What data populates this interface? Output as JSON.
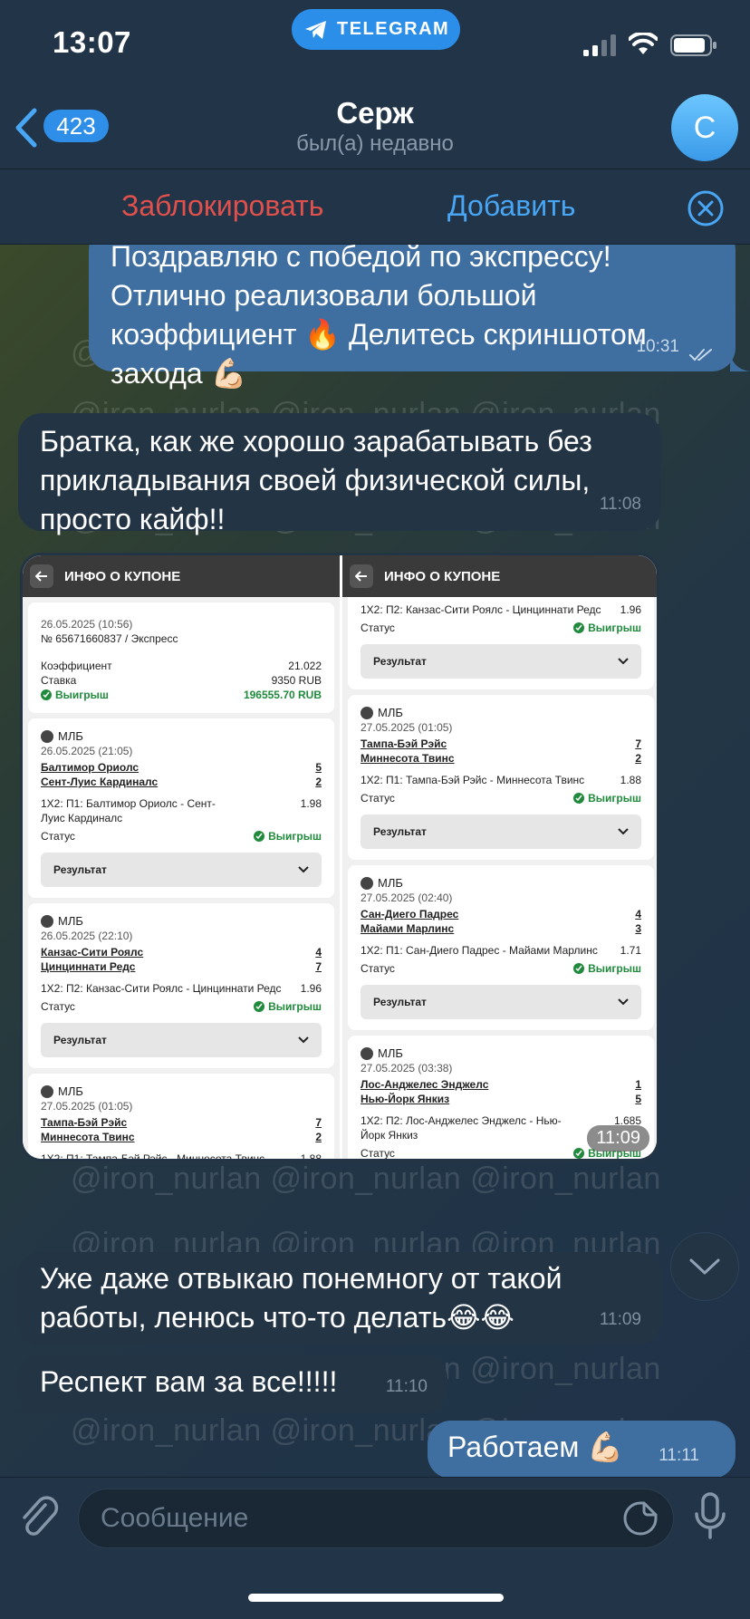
{
  "status_bar": {
    "time": "13:07",
    "app_pill": "TELEGRAM"
  },
  "header": {
    "back_count": "423",
    "title": "Серж",
    "subtitle": "был(а) недавно",
    "avatar_letter": "С",
    "block_label": "Заблокировать",
    "add_label": "Добавить"
  },
  "watermark": "@iron_nurlan  @iron_nurlan  @iron_nurlan",
  "messages": [
    {
      "dir": "out",
      "text": "Поздравляю с победой по экспрессу!\nОтлично реализовали большой\nкоэффициент 🔥 Делитесь скриншотом\nзахода 💪🏻",
      "time": "10:31"
    },
    {
      "dir": "in",
      "text": "Братка, как же хорошо зарабатывать без\nприкладывания своей физической силы,\nпросто кайф!!",
      "time": "11:08"
    },
    {
      "dir": "in",
      "type": "photo",
      "time": "11:09"
    },
    {
      "dir": "in",
      "text": "Уже даже отвыкаю понемногу от такой\nработы, ленюсь что-то делать😂😂",
      "time": "11:09"
    },
    {
      "dir": "in",
      "text": "Респект вам за все!!!!!",
      "time": "11:10"
    },
    {
      "dir": "out",
      "text": "Работаем 💪🏻",
      "time": "11:11"
    }
  ],
  "photo": {
    "header_title": "ИНФО О КУПОНЕ",
    "result_label": "Результат",
    "status_label": "Статус",
    "win_label": "Выигрыш",
    "league": "МЛБ",
    "summary": {
      "date": "26.05.2025 (10:56)",
      "number": "№ 65671660837 / Экспресс",
      "coef_label": "Коэффициент",
      "coef_value": "21.022",
      "stake_label": "Ставка",
      "stake_value": "9350 RUB",
      "win_value": "196555.70 RUB"
    },
    "events": [
      {
        "date": "26.05.2025 (21:05)",
        "team1": "Балтимор Ориолс",
        "score1": "5",
        "team2": "Сент-Луис Кардиналс",
        "score2": "2",
        "bet": "1Х2: П1: Балтимор Ориолс - Сент-Луис Кардиналс",
        "odds": "1.98"
      },
      {
        "date": "26.05.2025 (22:10)",
        "team1": "Канзас-Сити Роялс",
        "score1": "4",
        "team2": "Цинциннати Редс",
        "score2": "7",
        "bet": "1Х2: П2: Канзас-Сити Роялс - Цинциннати Редс",
        "odds": "1.96"
      },
      {
        "date": "27.05.2025 (01:05)",
        "team1": "Тампа-Бэй Рэйс",
        "score1": "7",
        "team2": "Миннесота Твинс",
        "score2": "2",
        "bet": "1Х2: П1: Тампа-Бэй Рэйс - Миннесота Твинс",
        "odds": "1.88"
      },
      {
        "date": "27.05.2025 (02:40)",
        "team1": "Сан-Диего Падрес",
        "score1": "4",
        "team2": "Майами Марлинс",
        "score2": "3",
        "bet": "1Х2: П1: Сан-Диего Падрес - Майами Марлинс",
        "odds": "1.71"
      },
      {
        "date": "27.05.2025 (03:38)",
        "team1": "Лос-Анджелес Энджелс",
        "score1": "1",
        "team2": "Нью-Йорк Янкиз",
        "score2": "5",
        "bet": "1Х2: П2: Лос-Анджелес Энджелс - Нью-Йорк Янкиз",
        "odds": "1.685"
      }
    ]
  },
  "input": {
    "placeholder": "Сообщение"
  }
}
